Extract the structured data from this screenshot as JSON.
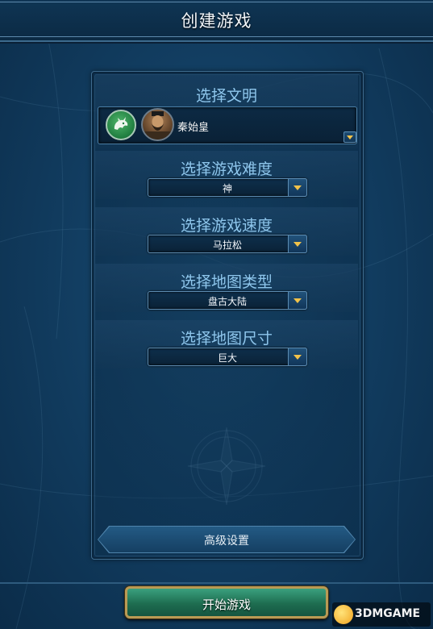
{
  "window": {
    "title": "创建游戏"
  },
  "civilization": {
    "section_label": "选择文明",
    "leader_name": "秦始皇",
    "civ_icon": "dragon-icon",
    "leader_icon": "leader-portrait"
  },
  "difficulty": {
    "section_label": "选择游戏难度",
    "value": "神"
  },
  "speed": {
    "section_label": "选择游戏速度",
    "value": "马拉松"
  },
  "map_type": {
    "section_label": "选择地图类型",
    "value": "盘古大陆"
  },
  "map_size": {
    "section_label": "选择地图尺寸",
    "value": "巨大"
  },
  "advanced": {
    "label": "高级设置"
  },
  "start": {
    "label": "开始游戏"
  },
  "watermark": {
    "brand": "3DMGAME"
  },
  "colors": {
    "accent_text": "#8ec6ec",
    "dropdown_arrow": "#f1c24a",
    "start_button": "#1e6d50"
  }
}
